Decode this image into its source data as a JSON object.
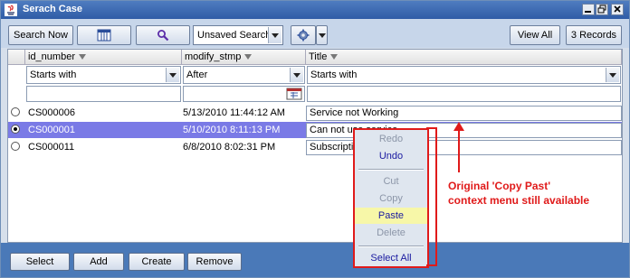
{
  "window": {
    "title": "Serach Case"
  },
  "toolbar": {
    "search_now": "Search Now",
    "saved_search": "Unsaved Search",
    "view_all": "View All",
    "record_count": "3 Records"
  },
  "columns": [
    {
      "label": "id_number",
      "filter": "Starts with"
    },
    {
      "label": "modify_stmp",
      "filter": "After"
    },
    {
      "label": "Title",
      "filter": "Starts with"
    }
  ],
  "rows": [
    {
      "id": "CS000006",
      "stamp": "5/13/2010 11:44:12 AM",
      "title": "Service not Working"
    },
    {
      "id": "CS000001",
      "stamp": "5/10/2010 8:11:13 PM",
      "title": "Can not use service"
    },
    {
      "id": "CS000011",
      "stamp": "6/8/2010 8:02:31 PM",
      "title": "Subscription"
    }
  ],
  "context_menu": {
    "redo": "Redo",
    "undo": "Undo",
    "cut": "Cut",
    "copy": "Copy",
    "paste": "Paste",
    "delete": "Delete",
    "select_all": "Select All"
  },
  "annotation": {
    "line1": "Original 'Copy Past'",
    "line2": "context menu still available"
  },
  "footer": {
    "select": "Select",
    "add": "Add",
    "create": "Create",
    "remove": "Remove"
  },
  "colors": {
    "titlebar": "#2f5ca6",
    "selection": "#7a7ae6",
    "annotation": "#e01a1a",
    "highlight": "#f7f7a8",
    "footer": "#4a79b8"
  }
}
